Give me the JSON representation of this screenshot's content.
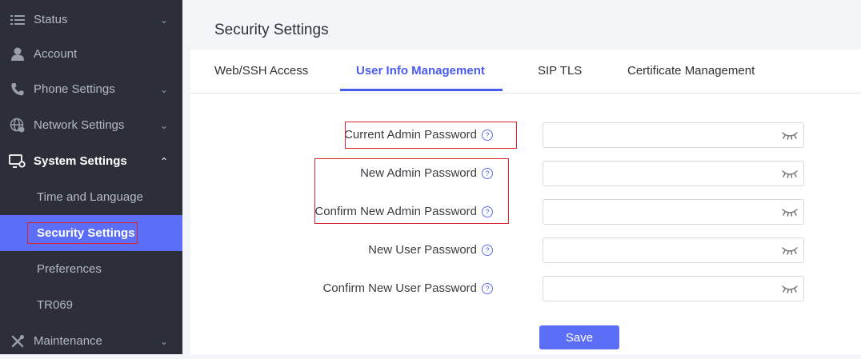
{
  "sidebar": {
    "items": [
      {
        "label": "Status",
        "icon": "list-icon",
        "chevron": "⌄"
      },
      {
        "label": "Account",
        "icon": "user-icon",
        "chevron": ""
      },
      {
        "label": "Phone Settings",
        "icon": "phone-icon",
        "chevron": "⌄"
      },
      {
        "label": "Network Settings",
        "icon": "network-globe-icon",
        "chevron": "⌄"
      },
      {
        "label": "System Settings",
        "icon": "system-settings-icon",
        "chevron": "⌃"
      },
      {
        "label": "Maintenance",
        "icon": "tools-icon",
        "chevron": "⌄"
      }
    ],
    "subitems": [
      {
        "label": "Time and Language"
      },
      {
        "label": "Security Settings"
      },
      {
        "label": "Preferences"
      },
      {
        "label": "TR069"
      }
    ]
  },
  "page": {
    "title": "Security Settings"
  },
  "tabs": [
    {
      "label": "Web/SSH Access"
    },
    {
      "label": "User Info Management"
    },
    {
      "label": "SIP TLS"
    },
    {
      "label": "Certificate Management"
    }
  ],
  "form": {
    "fields": [
      {
        "label": "Current Admin Password",
        "value": ""
      },
      {
        "label": "New Admin Password",
        "value": ""
      },
      {
        "label": "Confirm New Admin Password",
        "value": ""
      },
      {
        "label": "New User Password",
        "value": ""
      },
      {
        "label": "Confirm New User Password",
        "value": ""
      }
    ],
    "help_glyph": "?",
    "save_label": "Save"
  },
  "colors": {
    "accent": "#5b6ef5",
    "sidebar_bg": "#2c2f3a",
    "highlight_red": "#d9262e"
  }
}
